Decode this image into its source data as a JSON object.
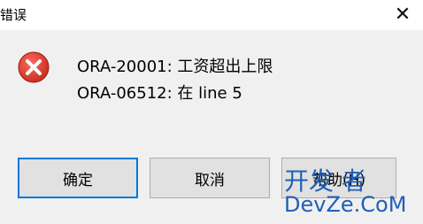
{
  "window": {
    "title": "错误",
    "close_symbol": "✕"
  },
  "message": {
    "icon": "error-icon",
    "line1": "ORA-20001: 工资超出上限",
    "line2": "ORA-06512: 在 line 5"
  },
  "buttons": {
    "ok": "确定",
    "cancel": "取消",
    "help": "帮助(H)"
  },
  "watermark": {
    "top": "开发 者",
    "bottom": "DevZe.CoM"
  },
  "colors": {
    "background": "#f0f0f0",
    "titlebar": "#ffffff",
    "error_red": "#c42b1c",
    "focus_border": "#0078d7",
    "button_face": "#e1e1e1",
    "watermark": "#1f5fb8"
  }
}
